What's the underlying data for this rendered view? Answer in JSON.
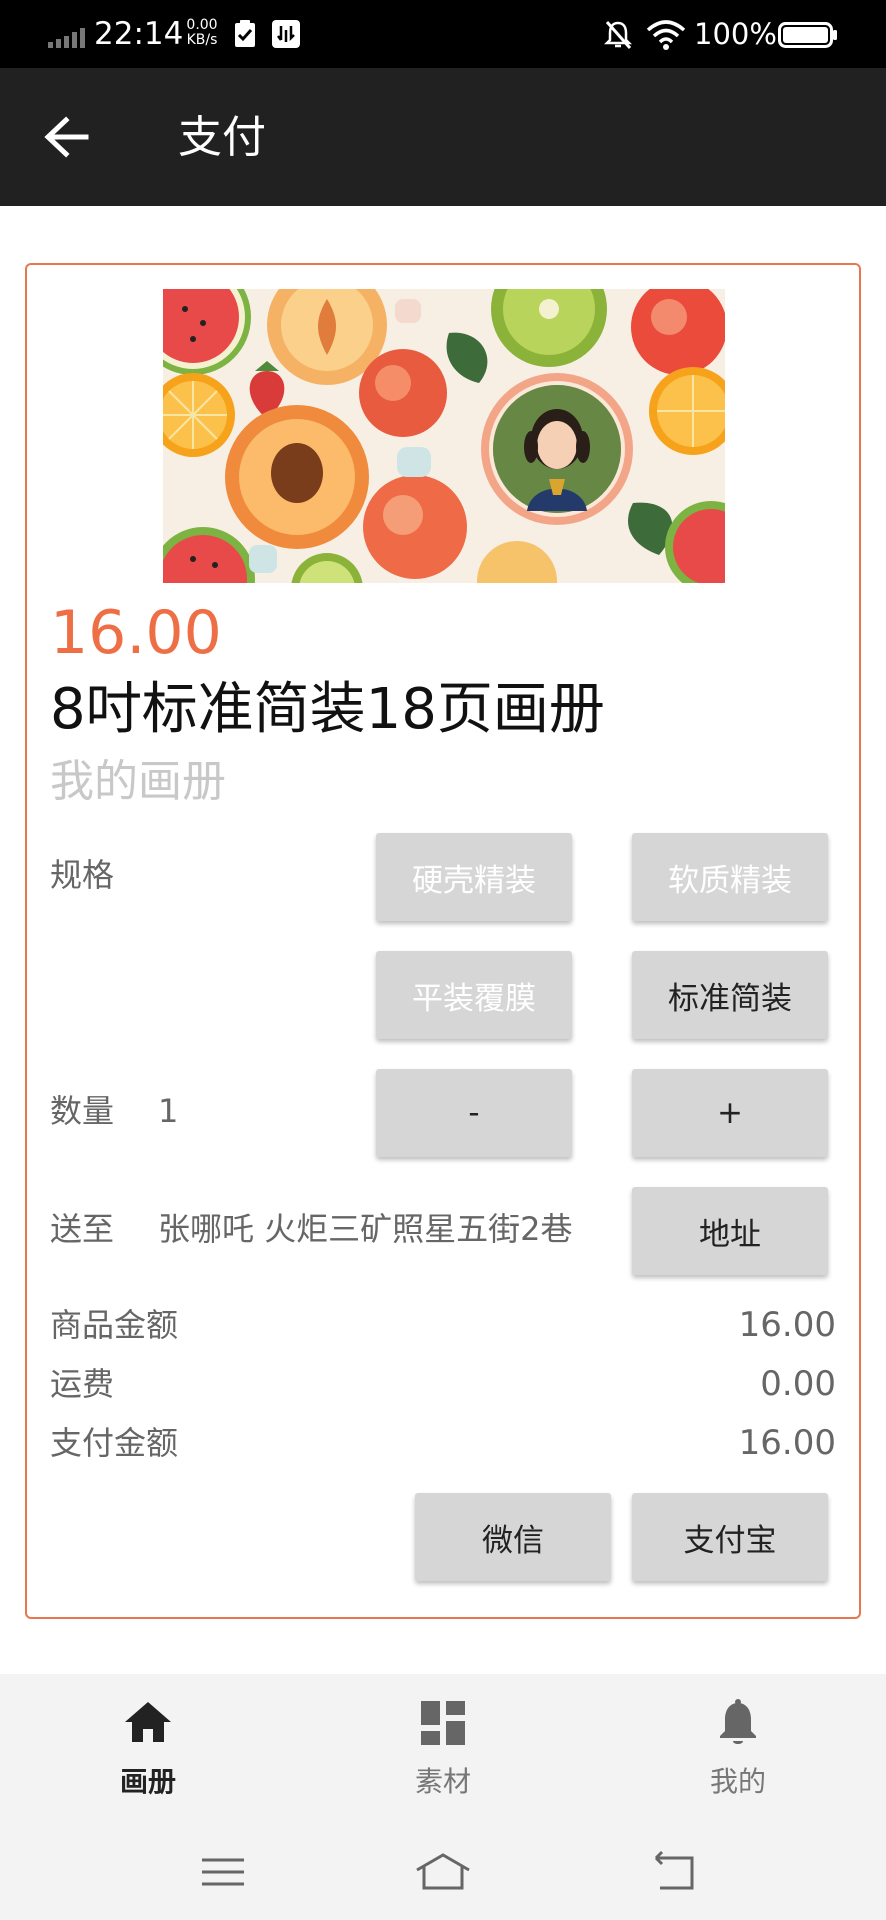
{
  "status_bar": {
    "time": "22:14",
    "speed_value": "0.00",
    "speed_unit": "KB/s",
    "battery": "100%"
  },
  "app_bar": {
    "title": "支付"
  },
  "product": {
    "price": "16.00",
    "title": "8吋标准简装18页画册",
    "subtitle": "我的画册"
  },
  "spec": {
    "label": "规格",
    "options": [
      "硬壳精装",
      "软质精装",
      "平装覆膜",
      "标准简装"
    ],
    "selected": "标准简装"
  },
  "quantity": {
    "label": "数量",
    "value": "1",
    "minus": "-",
    "plus": "+"
  },
  "shipping": {
    "label": "送至",
    "address": "张哪吒 火炬三矿照星五街2巷",
    "address_button": "地址"
  },
  "summary": {
    "goods_label": "商品金额",
    "goods_value": "16.00",
    "freight_label": "运费",
    "freight_value": "0.00",
    "pay_label": "支付金额",
    "pay_value": "16.00"
  },
  "payment": {
    "wechat": "微信",
    "alipay": "支付宝"
  },
  "bottom_nav": {
    "items": [
      {
        "label": "画册",
        "icon": "home-icon",
        "active": true
      },
      {
        "label": "素材",
        "icon": "dashboard-icon",
        "active": false
      },
      {
        "label": "我的",
        "icon": "bell-icon",
        "active": false
      }
    ]
  },
  "colors": {
    "accent": "#ee6f45",
    "card_border": "#e8764f",
    "app_bar": "#212121",
    "button_bg": "#d6d6d6"
  }
}
